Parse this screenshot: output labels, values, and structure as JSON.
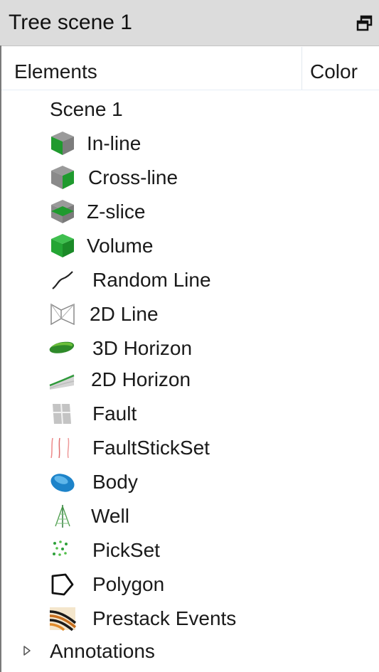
{
  "window": {
    "title": "Tree scene 1",
    "float_icon": "float-window-icon"
  },
  "columns": {
    "elements": "Elements",
    "color": "Color"
  },
  "tree": {
    "scene": "Scene 1",
    "items": [
      {
        "label": "In-line",
        "icon": "inline-icon"
      },
      {
        "label": "Cross-line",
        "icon": "crossline-icon"
      },
      {
        "label": "Z-slice",
        "icon": "zslice-icon"
      },
      {
        "label": "Volume",
        "icon": "volume-icon"
      },
      {
        "label": "Random Line",
        "icon": "random-line-icon"
      },
      {
        "label": "2D Line",
        "icon": "2d-line-icon"
      },
      {
        "label": "3D Horizon",
        "icon": "3d-horizon-icon"
      },
      {
        "label": "2D Horizon",
        "icon": "2d-horizon-icon"
      },
      {
        "label": "Fault",
        "icon": "fault-icon"
      },
      {
        "label": "FaultStickSet",
        "icon": "faultstickset-icon"
      },
      {
        "label": "Body",
        "icon": "body-icon"
      },
      {
        "label": "Well",
        "icon": "well-icon"
      },
      {
        "label": "PickSet",
        "icon": "pickset-icon"
      },
      {
        "label": "Polygon",
        "icon": "polygon-icon"
      },
      {
        "label": "Prestack Events",
        "icon": "prestack-events-icon"
      }
    ],
    "annotations": "Annotations"
  },
  "colors": {
    "titlebar_bg": "#dcdcdc",
    "green": "#1f9a2e",
    "grey_cube": "#8a8a8a",
    "body_blue": "#1d83c9"
  }
}
